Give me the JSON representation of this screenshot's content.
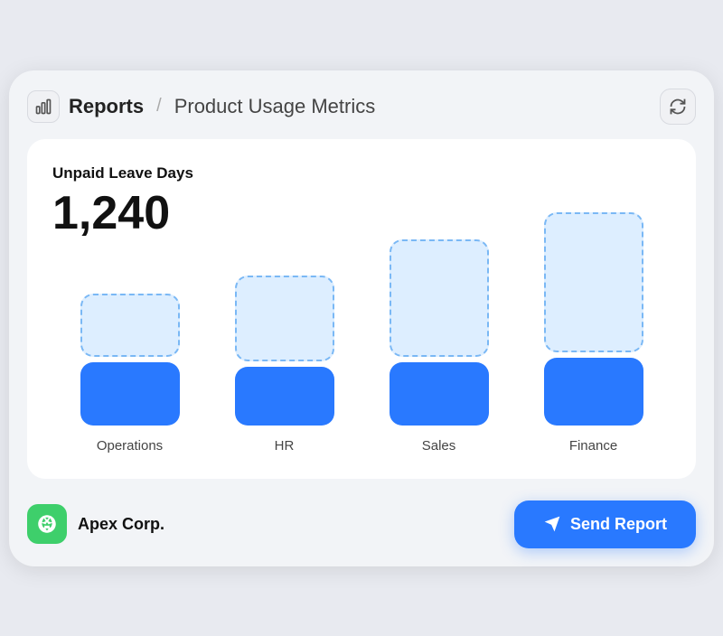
{
  "header": {
    "reports_label": "Reports",
    "separator": "/",
    "page_title": "Product Usage Metrics",
    "refresh_label": "Refresh"
  },
  "chart": {
    "metric_label": "Unpaid Leave Days",
    "metric_value": "1,240",
    "bars": [
      {
        "label": "Operations",
        "dashed_height": 70,
        "solid_height": 70
      },
      {
        "label": "HR",
        "dashed_height": 95,
        "solid_height": 65
      },
      {
        "label": "Sales",
        "dashed_height": 130,
        "solid_height": 70
      },
      {
        "label": "Finance",
        "dashed_height": 155,
        "solid_height": 75
      }
    ]
  },
  "footer": {
    "company_name": "Apex Corp.",
    "send_button_label": "Send Report"
  }
}
